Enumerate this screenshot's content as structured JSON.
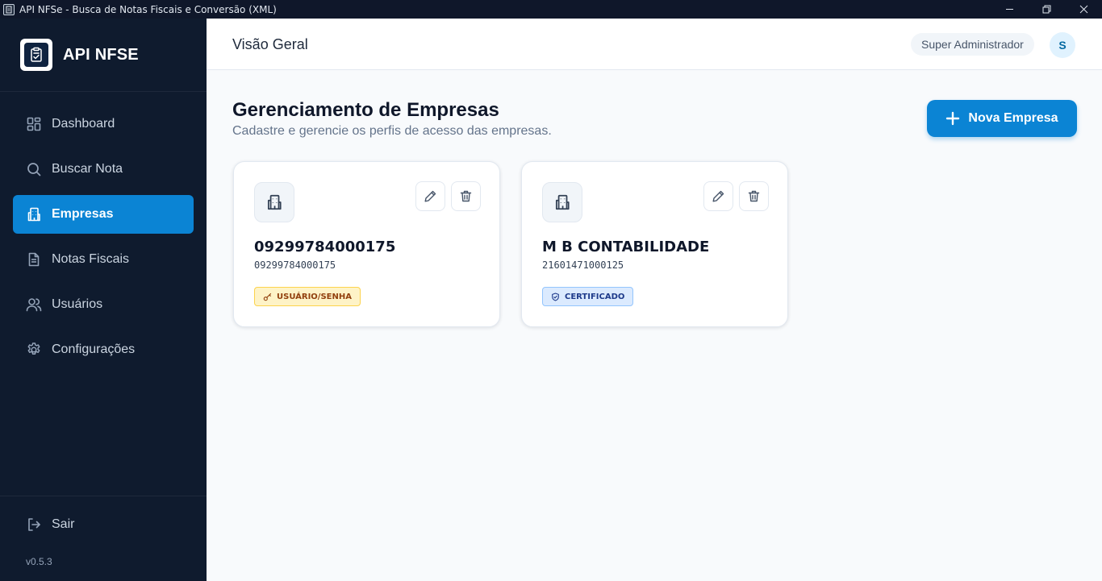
{
  "window": {
    "title": "API NFSe - Busca de Notas Fiscais e Conversão (XML)",
    "controls": [
      "minimize-icon",
      "restore-icon",
      "close-icon"
    ]
  },
  "sidebar": {
    "brand": "API NFSE",
    "items": [
      {
        "label": "Dashboard",
        "icon": "grid-icon",
        "active": false
      },
      {
        "label": "Buscar Nota",
        "icon": "search-icon",
        "active": false
      },
      {
        "label": "Empresas",
        "icon": "building-icon",
        "active": true
      },
      {
        "label": "Notas Fiscais",
        "icon": "document-icon",
        "active": false
      },
      {
        "label": "Usuários",
        "icon": "users-icon",
        "active": false
      },
      {
        "label": "Configurações",
        "icon": "gear-icon",
        "active": false
      }
    ],
    "logout_label": "Sair",
    "version": "v0.5.3"
  },
  "header": {
    "title": "Visão Geral",
    "user_role": "Super Administrador",
    "avatar_initial": "S"
  },
  "main": {
    "title": "Gerenciamento de Empresas",
    "subtitle": "Cadastre e gerencie os perfis de acesso das empresas.",
    "new_button_label": "Nova Empresa",
    "companies": [
      {
        "name": "09299784000175",
        "cnpj": "09299784000175",
        "badge": "USUÁRIO/SENHA",
        "badge_icon": "key-icon"
      },
      {
        "name": "M B CONTABILIDADE",
        "cnpj": "21601471000125",
        "badge": "CERTIFICADO",
        "badge_icon": "shield-icon"
      }
    ]
  },
  "colors": {
    "sidebar_bg": "#0f1b2e",
    "accent": "#0b84d4",
    "badge_user_bg": "#fef3c7",
    "badge_cert_bg": "#dbeafe"
  }
}
